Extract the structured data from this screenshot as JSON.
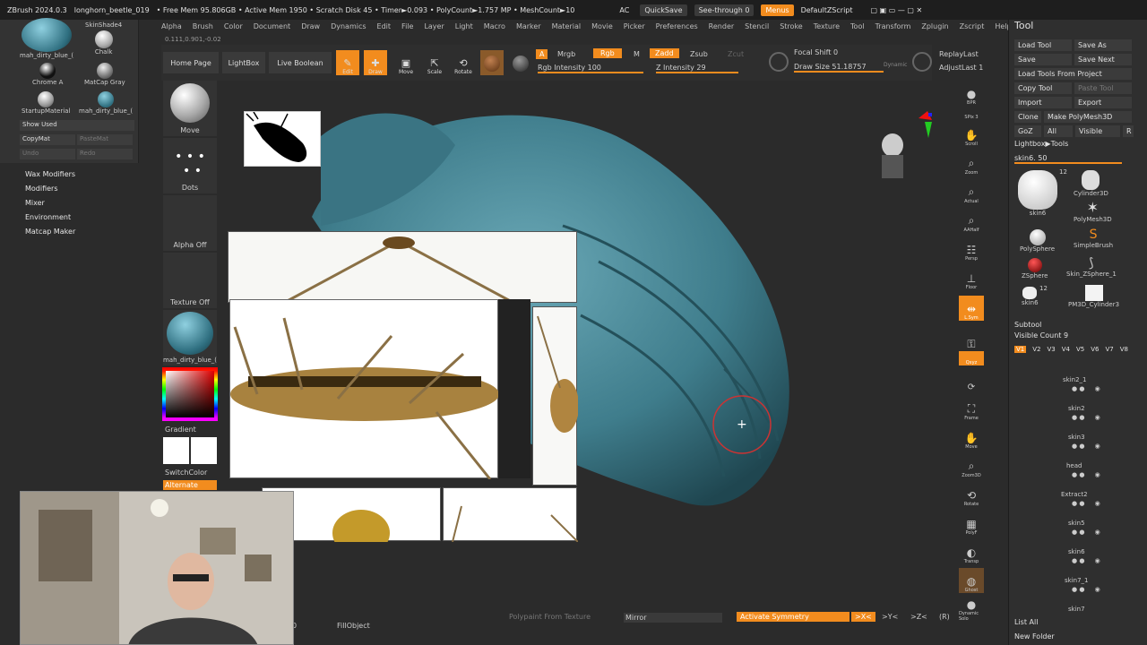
{
  "titlebar": {
    "app": "ZBrush 2024.0.3",
    "doc": "longhorn_beetle_019",
    "stats": "• Free Mem 95.806GB • Active Mem 1950 • Scratch Disk 45 • Timer►0.093 • PolyCount►1.757 MP • MeshCount►10",
    "ac": "AC",
    "quicksave": "QuickSave",
    "seethrough": "See-through 0",
    "menus": "Menus",
    "defaultzscript": "DefaultZScript"
  },
  "menubar": [
    "Alpha",
    "Brush",
    "Color",
    "Document",
    "Draw",
    "Dynamics",
    "Edit",
    "File",
    "Layer",
    "Light",
    "Macro",
    "Marker",
    "Material",
    "Movie",
    "Picker",
    "Preferences",
    "Render",
    "Stencil",
    "Stroke",
    "Texture",
    "Tool",
    "Transform",
    "Zplugin",
    "Zscript",
    "Help"
  ],
  "coords": "0.111,0.901,-0.02",
  "leftpanel": {
    "mats": [
      "mah_dirty_blue_(",
      "SkinShade4",
      "Chalk",
      "Chrome A",
      "MatCap Gray",
      "StartupMaterial",
      "mah_dirty_blue_("
    ],
    "show_used": "Show Used",
    "copymat": "CopyMat",
    "pastemat": "PasteMat",
    "undo": "Undo",
    "redo": "Redo"
  },
  "leftmenu": [
    "Wax Modifiers",
    "Modifiers",
    "Mixer",
    "Environment",
    "Matcap Maker"
  ],
  "toolbar": {
    "home": "Home Page",
    "lightbox": "LightBox",
    "liveboolean": "Live Boolean",
    "edit": "Edit",
    "draw": "Draw",
    "move": "Move",
    "scale": "Scale",
    "rotate": "Rotate",
    "a": "A",
    "mrgb": "Mrgb",
    "rgb": "Rgb",
    "m": "M",
    "zadd": "Zadd",
    "zsub": "Zsub",
    "zcut": "Zcut",
    "rgb_intensity": "Rgb Intensity 100",
    "z_intensity": "Z Intensity 29",
    "focal_shift": "Focal Shift 0",
    "draw_size": "Draw Size 51.18757",
    "dynamic": "Dynamic",
    "replaylast": "ReplayLast",
    "adjustlast": "AdjustLast 1"
  },
  "leftshelf": {
    "move": "Move",
    "dots": "Dots",
    "alpha_off": "Alpha Off",
    "texture_off": "Texture Off",
    "material": "mah_dirty_blue_(",
    "gradient": "Gradient",
    "switchcolor": "SwitchColor",
    "alternate": "Alternate"
  },
  "rightshelf": [
    "BPR",
    "SPix 3",
    "Scroll",
    "Zoom",
    "Actual",
    "AAHalf",
    "Persp",
    "Floor",
    "L.Sym",
    "Qxyz",
    "Frame",
    "Move",
    "Zoom3D",
    "Rotate",
    "PolyF",
    "Transp",
    "Ghost",
    "Dynamic Solo"
  ],
  "toolpanel": {
    "title": "Tool",
    "load_tool": "Load Tool",
    "save_as": "Save As",
    "save": "Save",
    "save_next": "Save Next",
    "load_tools_from_project": "Load Tools From Project",
    "copy_tool": "Copy Tool",
    "paste_tool": "Paste Tool",
    "import": "Import",
    "export": "Export",
    "clone": "Clone",
    "make_polymesh3d": "Make PolyMesh3D",
    "goz": "GoZ",
    "all": "All",
    "visible": "Visible",
    "r": "R",
    "lightbox_tools": "Lightbox▶Tools",
    "skin_slider": "skin6. 50",
    "tools": [
      "skin6",
      "Cylinder3D",
      "PolyMesh3D",
      "PolySphere",
      "SimpleBrush",
      "ZSphere",
      "Skin_ZSphere_1",
      "skin6",
      "PM3D_Cylinder3"
    ],
    "tool_count": "12",
    "subtool": "Subtool",
    "visible_count": "Visible Count 9",
    "versions": [
      "V1",
      "V2",
      "V3",
      "V4",
      "V5",
      "V6",
      "V7",
      "V8"
    ],
    "subtools": [
      "skin2_1",
      "skin2",
      "skin3",
      "head",
      "Extract2",
      "skin5",
      "skin6",
      "skin7_1",
      "skin7"
    ],
    "list_all": "List All",
    "new_folder": "New Folder"
  },
  "bottombar": {
    "zero": "0",
    "fillobject": "FillObject",
    "polypaint": "Polypaint From Texture",
    "mirror": "Mirror",
    "activate_symmetry": "Activate Symmetry",
    "x": ">X<",
    "y": ">Y<",
    "z": ">Z<",
    "r": "(R)"
  },
  "colors": {
    "accent": "#f28c1e",
    "mesh": "#3f7d8c",
    "panel": "#2f2f2f"
  }
}
